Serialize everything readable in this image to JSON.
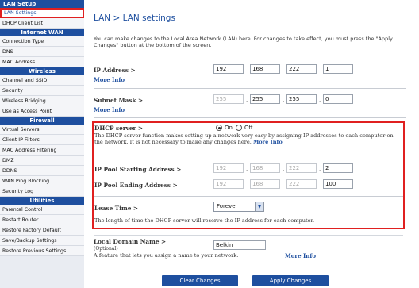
{
  "sidebar": {
    "sections": [
      {
        "title": "LAN Setup",
        "items": [
          "LAN Settings",
          "DHCP Client List"
        ]
      },
      {
        "title": "Internet WAN",
        "items": [
          "Connection Type",
          "DNS",
          "MAC Address"
        ]
      },
      {
        "title": "Wireless",
        "items": [
          "Channel and SSID",
          "Security",
          "Wireless Bridging",
          "Use as Access Point"
        ]
      },
      {
        "title": "Firewall",
        "items": [
          "Virtual Servers",
          "Client IP Filters",
          "MAC Address Filtering",
          "DMZ",
          "DDNS",
          "WAN Ping Blocking",
          "Security Log"
        ]
      },
      {
        "title": "Utilities",
        "items": [
          "Parental Control",
          "Restart Router",
          "Restore Factory Default",
          "Save/Backup Settings",
          "Restore Previous Settings"
        ]
      }
    ]
  },
  "page": {
    "title": "LAN > LAN settings",
    "intro": "You can make changes to the Local Area Network (LAN) here. For changes to take effect, you must press the \"Apply Changes\" button at the bottom of the screen."
  },
  "ip": {
    "label": "IP Address >",
    "more": "More Info",
    "octets": [
      "192",
      "168",
      "222",
      "1"
    ]
  },
  "subnet": {
    "label": "Subnet Mask >",
    "more": "More Info",
    "octets": [
      "255",
      "255",
      "255",
      "0"
    ]
  },
  "dhcp": {
    "label": "DHCP server >",
    "on": "On",
    "off": "Off",
    "selected": "On",
    "desc": "The DHCP server function makes setting up a network very easy by assigning IP addresses to each computer on the network. It is not necessary to make any changes here.",
    "more": "More Info",
    "start_label": "IP Pool Starting Address >",
    "start": [
      "192",
      "168",
      "222",
      "2"
    ],
    "end_label": "IP Pool Ending Address >",
    "end": [
      "192",
      "168",
      "222",
      "100"
    ],
    "lease_label": "Lease Time >",
    "lease_value": "Forever",
    "lease_note": "The length of time the DHCP server will reserve the IP address for each computer."
  },
  "domain": {
    "label": "Local Domain Name >",
    "optional": "(Optional)",
    "desc": "A feature that lets you assign a name to your network.",
    "more": "More Info",
    "value": "Belkin"
  },
  "buttons": {
    "clear": "Clear Changes",
    "apply": "Apply Changes"
  },
  "colors": {
    "accent": "#1e4f9f",
    "highlight": "#e02020"
  }
}
